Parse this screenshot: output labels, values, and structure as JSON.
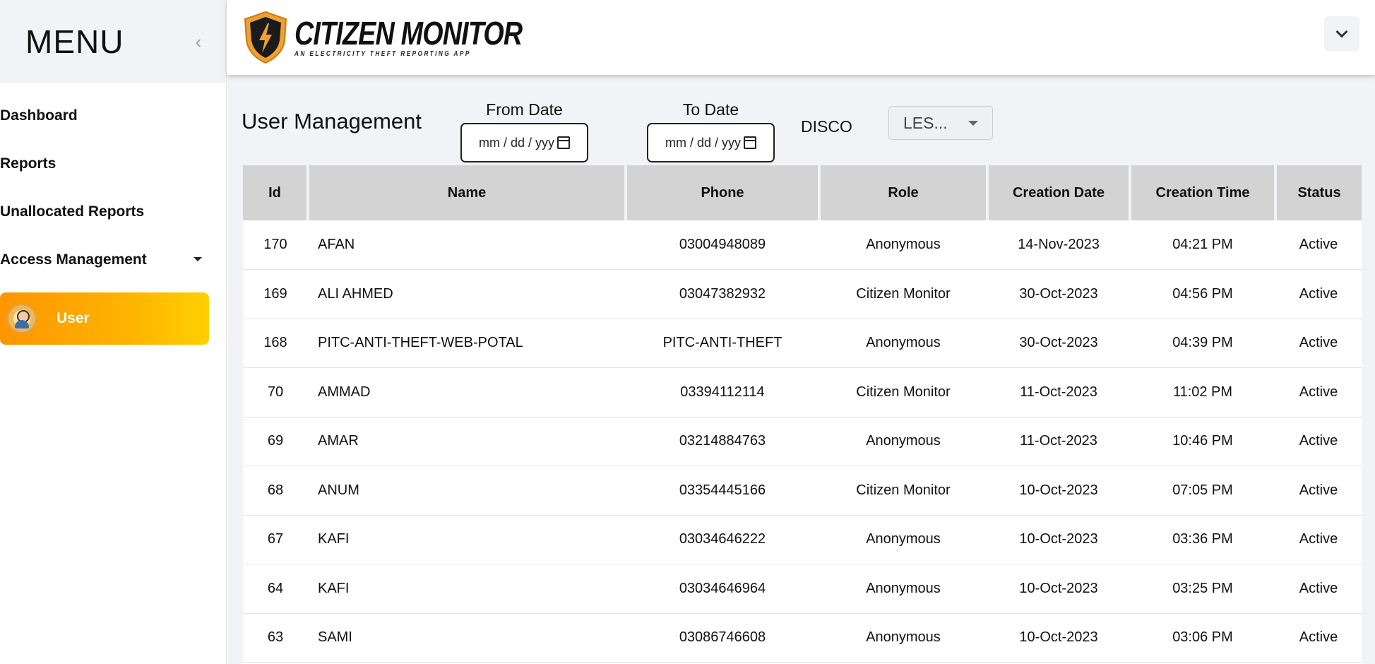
{
  "sidebar": {
    "menu_title": "MENU",
    "collapse_icon": "chevron-left-icon",
    "items": [
      {
        "label": "Dashboard"
      },
      {
        "label": "Reports"
      },
      {
        "label": "Unallocated Reports"
      },
      {
        "label": "Access Management"
      }
    ],
    "active_sub_item": {
      "label": "User",
      "icon": "user-gear-icon"
    },
    "active_gradient": [
      "#ff9500",
      "#ffd000"
    ]
  },
  "header": {
    "brand_name": "CITIZEN MONITOR",
    "brand_tagline": "AN ELECTRICITY THEFT REPORTING APP",
    "logo_icon": "lightning-shield-icon",
    "dropdown_icon": "chevron-down-icon"
  },
  "toolbar": {
    "title": "User Management",
    "from_date": {
      "label": "From Date",
      "placeholder": "mm / dd / yyy"
    },
    "to_date": {
      "label": "To Date",
      "placeholder": "mm / dd / yyy"
    },
    "disco_label": "DISCO",
    "disco_value": "LES..."
  },
  "table": {
    "columns": [
      "Id",
      "Name",
      "Phone",
      "Role",
      "Creation Date",
      "Creation Time",
      "Status"
    ],
    "rows": [
      [
        "170",
        "AFAN",
        "03004948089",
        "Anonymous",
        "14-Nov-2023",
        "04:21 PM",
        "Active"
      ],
      [
        "169",
        "ALI AHMED",
        "03047382932",
        "Citizen Monitor",
        "30-Oct-2023",
        "04:56 PM",
        "Active"
      ],
      [
        "168",
        "PITC-ANTI-THEFT-WEB-POTAL",
        "PITC-ANTI-THEFT",
        "Anonymous",
        "30-Oct-2023",
        "04:39 PM",
        "Active"
      ],
      [
        "70",
        "AMMAD",
        "03394112114",
        "Citizen Monitor",
        "11-Oct-2023",
        "11:02 PM",
        "Active"
      ],
      [
        "69",
        "AMAR",
        "03214884763",
        "Anonymous",
        "11-Oct-2023",
        "10:46 PM",
        "Active"
      ],
      [
        "68",
        "ANUM",
        "03354445166",
        "Citizen Monitor",
        "10-Oct-2023",
        "07:05 PM",
        "Active"
      ],
      [
        "67",
        "KAFI",
        "03034646222",
        "Anonymous",
        "10-Oct-2023",
        "03:36 PM",
        "Active"
      ],
      [
        "64",
        "KAFI",
        "03034646964",
        "Anonymous",
        "10-Oct-2023",
        "03:25 PM",
        "Active"
      ],
      [
        "63",
        "SAMI",
        "03086746608",
        "Anonymous",
        "10-Oct-2023",
        "03:06 PM",
        "Active"
      ]
    ]
  }
}
